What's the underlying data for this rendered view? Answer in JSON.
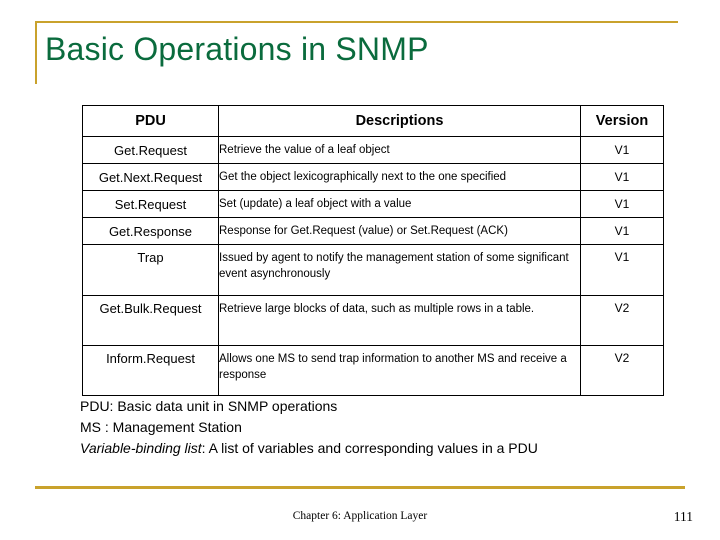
{
  "slide": {
    "title": "Basic Operations in SNMP",
    "accent_color": "#c9a22c",
    "title_color": "#0a6b3d"
  },
  "table": {
    "headers": {
      "pdu": "PDU",
      "descriptions": "Descriptions",
      "version": "Version"
    },
    "rows": [
      {
        "pdu": "Get.Request",
        "description": "Retrieve the value of a leaf object",
        "version": "V1"
      },
      {
        "pdu": "Get.Next.Request",
        "description": "Get the object lexicographically next to the one specified",
        "version": "V1"
      },
      {
        "pdu": "Set.Request",
        "description": "Set (update) a leaf object with a value",
        "version": "V1"
      },
      {
        "pdu": "Get.Response",
        "description": "Response for Get.Request (value) or Set.Request (ACK)",
        "version": "V1"
      },
      {
        "pdu": "Trap",
        "description": "Issued by agent to notify the management station of some significant event asynchronously",
        "version": "V1"
      },
      {
        "pdu": "Get.Bulk.Request",
        "description": "Retrieve large blocks of data, such as multiple rows in a table.",
        "version": "V2"
      },
      {
        "pdu": "Inform.Request",
        "description": "Allows one MS to send trap information to another MS and receive a response",
        "version": "V2"
      }
    ]
  },
  "notes": {
    "line1": "PDU: Basic data unit in SNMP operations",
    "line2": "MS  : Management Station",
    "line3_term": "Variable-binding list",
    "line3_rest": ": A list of variables and corresponding values in a PDU"
  },
  "footer": {
    "center": "Chapter 6: Application Layer",
    "page_number": "111"
  }
}
